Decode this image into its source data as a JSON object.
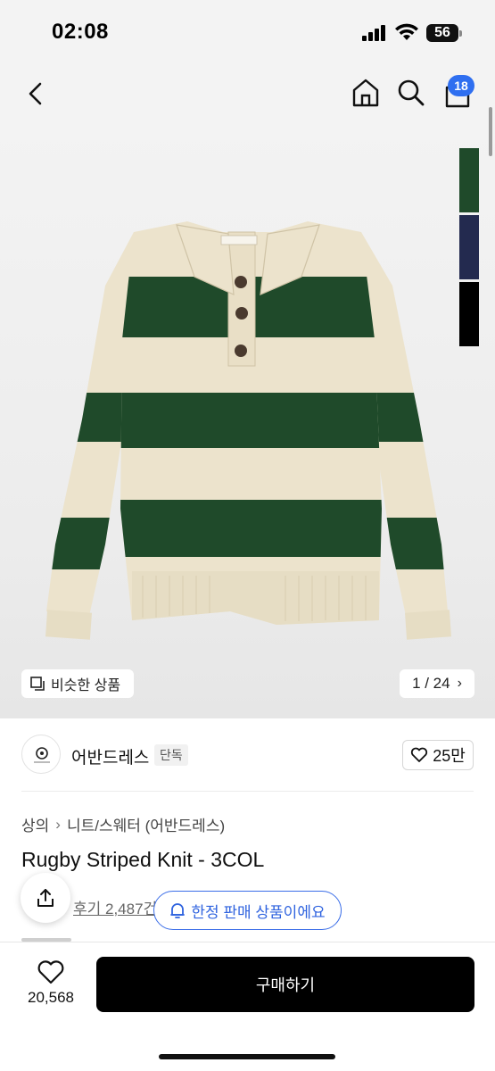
{
  "status_bar": {
    "time": "02:08",
    "battery": "56"
  },
  "header": {
    "cart_count": "18"
  },
  "product_image": {
    "similar_label": "비슷한 상품",
    "page_counter": "1 / 24",
    "swatches": [
      {
        "name": "green",
        "color": "#1f4a2a"
      },
      {
        "name": "navy",
        "color": "#232a4f"
      },
      {
        "name": "black",
        "color": "#000000"
      }
    ]
  },
  "brand": {
    "name": "어반드레스",
    "tag": "단독",
    "likes": "25만"
  },
  "breadcrumb": [
    "상의",
    "니트/스웨터 (어반드레스)"
  ],
  "product": {
    "title": "Rugby Striped Knit - 3COL",
    "review_label": "후기 2,487건",
    "limited_label": "한정 판매 상품이에요"
  },
  "bottom_bar": {
    "wish_count": "20,568",
    "buy_label": "구매하기"
  },
  "colors": {
    "accent": "#2f6ff0",
    "stripe_green": "#1f4a2a",
    "stripe_cream": "#ece3cc"
  }
}
